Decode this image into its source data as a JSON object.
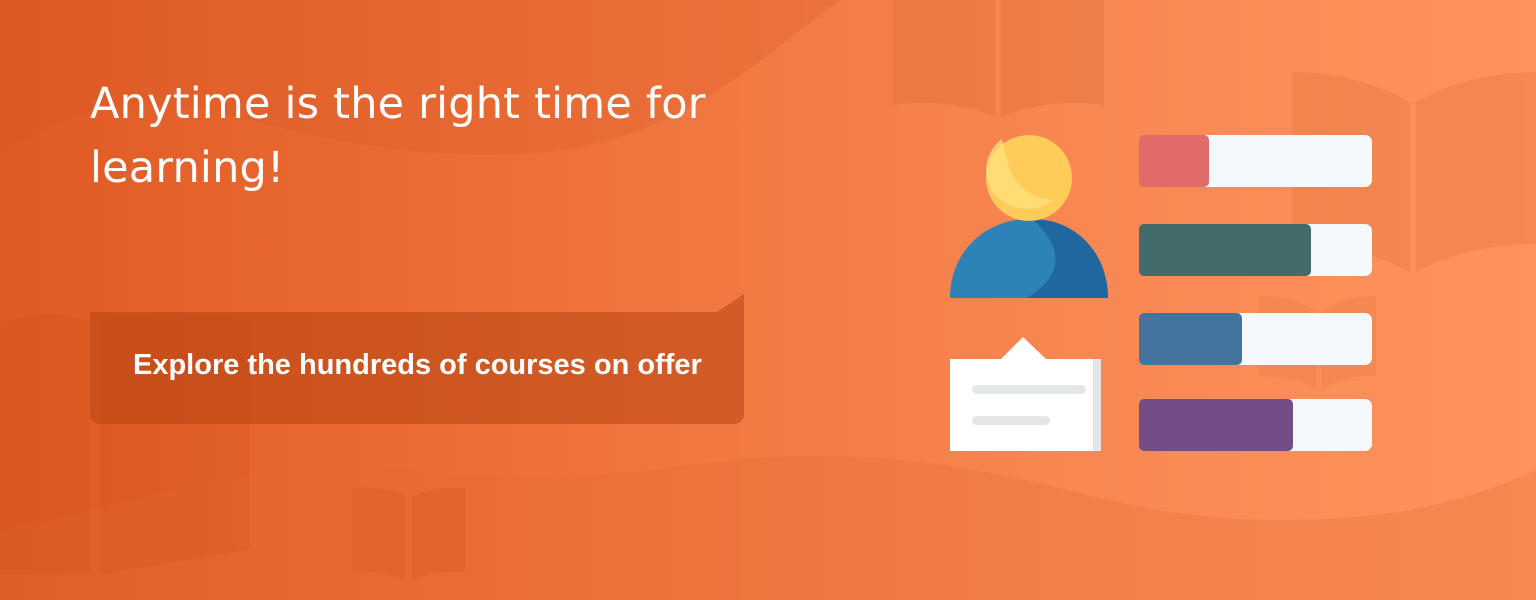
{
  "banner": {
    "headline": "Anytime is the right time for learning!",
    "cta_label": "Explore the hundreds of courses on offer"
  },
  "illustration": {
    "icons": [
      "user-icon",
      "chat-card-icon",
      "progress-bar-icon"
    ],
    "bars": [
      {
        "progress": 0.3,
        "color": "#e06c6a"
      },
      {
        "progress": 0.74,
        "color": "#436b6b"
      },
      {
        "progress": 0.44,
        "color": "#44749e"
      },
      {
        "progress": 0.66,
        "color": "#744c86"
      }
    ],
    "track_color": "#f5f8fd"
  },
  "theme": {
    "gradient_start": "#e05a24",
    "gradient_end": "#ff935d",
    "text_color": "#ffffff"
  }
}
